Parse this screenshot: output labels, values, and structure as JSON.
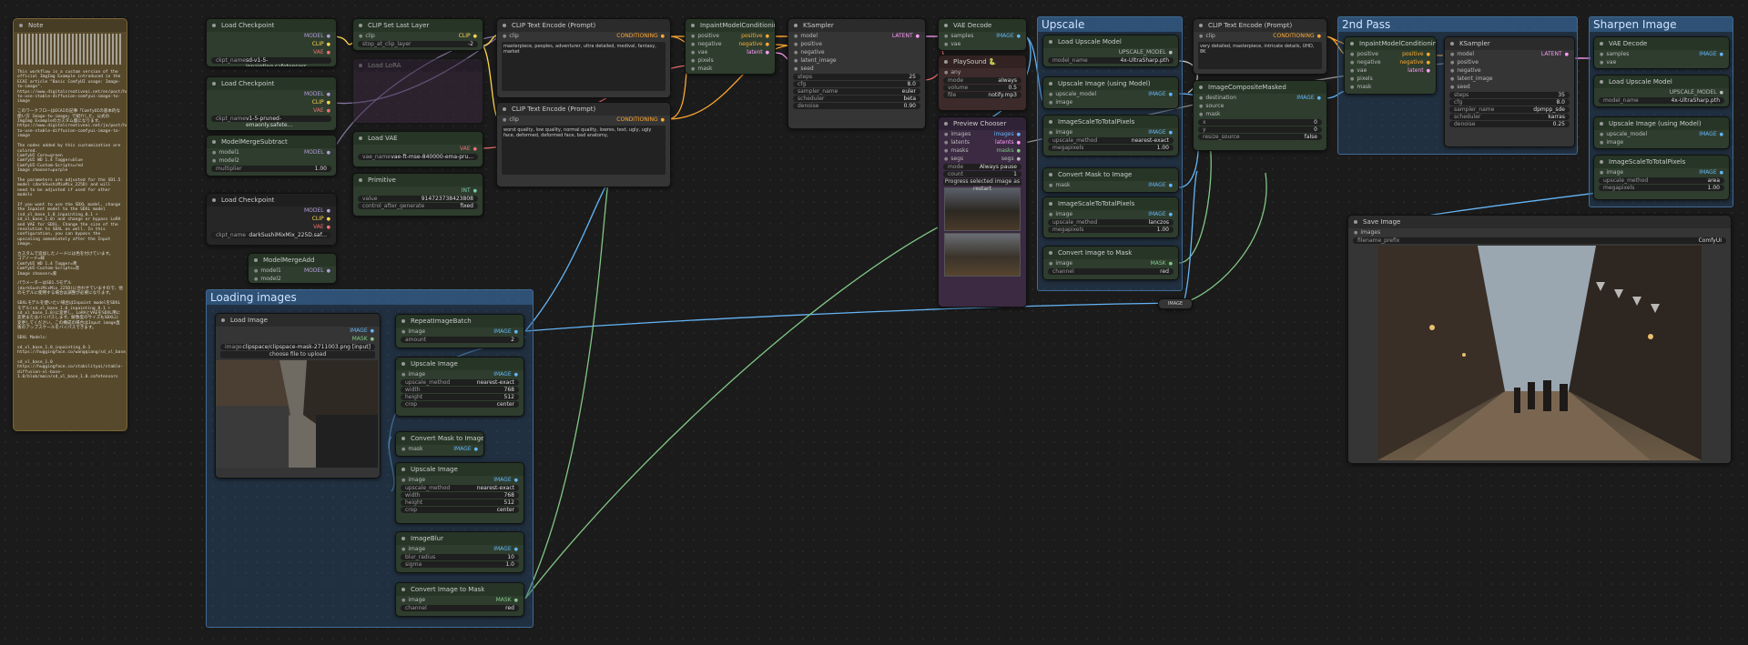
{
  "groups": {
    "loading": "Loading images",
    "upscale": "Upscale",
    "second_pass": "2nd Pass",
    "sharpen": "Sharpen Image"
  },
  "note": {
    "title": "Note",
    "body": "This workflow is a custom version of the official ImgImg Example introduced in the ECAI article \"Basic ComfyUI usage: Image-to-image\".\nhttps://www.digitalcreativeai.net/en/post/how-to-use-stable-diffusion-comfyui-image-to-image\n\nこのワークフローはECAIの記事「ComfyUIの基本的な使い方 Image-to-image」で紹介した、公式のImgImg Exampleのカスタム版になります。\nhttps://www.digitalcreativeai.net/ja/post/how-to-use-stable-diffusion-comfyui-image-to-image\n\nThe nodes added by this customization are colored.\nComfyUI Core=green\nComfyUI WD 1.4 Tagger=blue\nComfyUI-Custom-Scripts=red\nImage chooser=purple\n\nThe parameters are adjusted for the SD1.5 model (darkSushiMixMix_225D) and will need to be adjusted if used for other models\n\nIf you want to use the SDXL model, change the Inpaint model to the SDXL model (sd_xl_base_1.0_inpainting_0.1 + sd_xl_base_1.0) and change or bypass LoRA and VAE for SDXL. Change the size of the resolution to SDXL as well. In this configuration, you can bypass the upscaling immediately after the Input image.\n\nカスタムで追加したノードには色を付けています。\nコアノード=緑\nComfyUI WD 1.4 Tagger=青\nComfyUI-Custom-Scripts=赤\nImage chooser=紫\n\nパラメーターはSD1.5モデル(darkSushiMixMix_225D)に合わせていますので、他のモデルに使用する場合は調整が必要になります。\n\nSDXLモデルを使いたい場合はInpaint modelをSDXLモデル(sd_xl_base_1.0_inpainting_0.1 + sd_xl_base_1.0)に変更し、LoRAとVAEをSDXL用に変更またはバイパスします。解像度のサイズもSDXLに変更してください。この構成の場合はInput image直後のアップスケールをバイパスできます。\n\nSDXL Models:\n\nsd_xl_base_1.0_inpainting_0.1\nhttps://huggingface.co/wangqiang/sd_xl_base_1.0_inpainting_0.1.safetensors/tree/main\n\nsd_xl_base_1.0\nhttps://huggingface.co/stabilityai/stable-diffusion-xl-base-1.0/blob/main/sd_xl_base_1.0.safetensors"
  },
  "ckpt1": {
    "title": "Load Checkpoint",
    "outs": [
      "MODEL",
      "CLIP",
      "VAE"
    ],
    "w_label": "ckpt_name",
    "w_value": "sd-v1-5-inpainting.safetensors"
  },
  "ckpt2": {
    "title": "Load Checkpoint",
    "outs": [
      "MODEL",
      "CLIP",
      "VAE"
    ],
    "w_label": "ckpt_name",
    "w_value": "v1-5-pruned-emaonly.safete..."
  },
  "subtract": {
    "title": "ModelMergeSubtract",
    "ins": [
      "model1",
      "model2"
    ],
    "out": "MODEL",
    "w_label": "multiplier",
    "w_value": "1.00"
  },
  "ckpt3": {
    "title": "Load Checkpoint",
    "outs": [
      "MODEL",
      "CLIP",
      "VAE"
    ],
    "w_label": "ckpt_name",
    "w_value": "darkSushiMixMix_225D.saf..."
  },
  "mergeadd": {
    "title": "ModelMergeAdd",
    "ins": [
      "model1",
      "model2"
    ],
    "out": "MODEL"
  },
  "clipset": {
    "title": "CLIP Set Last Layer",
    "in": "clip",
    "out": "CLIP",
    "w_label": "stop_at_clip_layer",
    "w_value": "-2"
  },
  "lora": {
    "title": "Load LoRA"
  },
  "vae": {
    "title": "Load VAE",
    "out": "VAE",
    "w_label": "vae_name",
    "w_value": "vae-ft-mse-840000-ema-pru..."
  },
  "primitive": {
    "title": "Primitive",
    "out": "INT",
    "w1_label": "value",
    "w1_value": "914723738423808",
    "w2_label": "control_after_generate",
    "w2_value": "fixed"
  },
  "pos": {
    "title": "CLIP Text Encode (Prompt)",
    "in": "clip",
    "out": "CONDITIONING",
    "text": "masterpiece, peoples, adventurer, ultra detailed, medival, fantasy, market"
  },
  "neg": {
    "title": "CLIP Text Encode (Prompt)",
    "in": "clip",
    "out": "CONDITIONING",
    "text": "worst quality, low quality, normal quality, lowres, text, ugly, ugly face, deformed, deformed face, bad anatomy,"
  },
  "inpaint1": {
    "title": "InpaintModelConditioning",
    "ins": [
      "positive",
      "negative",
      "vae",
      "pixels",
      "mask"
    ],
    "outs": [
      "positive",
      "negative",
      "latent"
    ]
  },
  "ksampler1": {
    "title": "KSampler",
    "ins": [
      "model",
      "positive",
      "negative",
      "latent_image",
      "seed"
    ],
    "out": "LATENT",
    "widgets": [
      [
        "steps",
        "25"
      ],
      [
        "cfg",
        "8.0"
      ],
      [
        "sampler_name",
        "euler"
      ],
      [
        "scheduler",
        "beta"
      ],
      [
        "denoise",
        "0.90"
      ]
    ]
  },
  "vaedecode1": {
    "title": "VAE Decode",
    "ins": [
      "samples",
      "vae"
    ],
    "out": "IMAGE"
  },
  "playsound": {
    "title": "PlaySound 🐍",
    "ins": [
      "any"
    ],
    "widgets": [
      [
        "mode",
        "always"
      ],
      [
        "volume",
        "0.5"
      ],
      [
        "file",
        "notify.mp3"
      ]
    ]
  },
  "chooser": {
    "title": "Preview Chooser",
    "ins": [
      "images",
      "latents",
      "masks",
      "segs"
    ],
    "outs": [
      "images",
      "latents",
      "masks",
      "segs"
    ],
    "widgets": [
      [
        "mode",
        "Always pause"
      ],
      [
        "count",
        "1"
      ]
    ],
    "progress": "Progress selected image as restart"
  },
  "upmodel": {
    "title": "Load Upscale Model",
    "out": "UPSCALE_MODEL",
    "w_label": "model_name",
    "w_value": "4x-UltraSharp.pth"
  },
  "upwm": {
    "title": "Upscale Image (using Model)",
    "ins": [
      "upscale_model",
      "image"
    ],
    "out": "IMAGE"
  },
  "scaletotal1": {
    "title": "ImageScaleToTotalPixels",
    "in": "image",
    "out": "IMAGE",
    "widgets": [
      [
        "upscale_method",
        "nearest-exact"
      ],
      [
        "megapixels",
        "1.00"
      ]
    ]
  },
  "convmask1": {
    "title": "Convert Mask to Image",
    "in": "mask",
    "out": "IMAGE"
  },
  "scaletotal2": {
    "title": "ImageScaleToTotalPixels",
    "in": "image",
    "out": "IMAGE",
    "widgets": [
      [
        "upscale_method",
        "lanczos"
      ],
      [
        "megapixels",
        "1.00"
      ]
    ]
  },
  "convimg1": {
    "title": "Convert Image to Mask",
    "in": "image",
    "out": "MASK",
    "w_label": "channel",
    "w_value": "red"
  },
  "pos2": {
    "title": "CLIP Text Encode (Prompt)",
    "in": "clip",
    "out": "CONDITIONING",
    "text": "very detailed, masterpiece, intricate details, UHD, 8K"
  },
  "composite": {
    "title": "ImageCompositeMasked",
    "ins": [
      "destination",
      "source",
      "mask"
    ],
    "out": "IMAGE",
    "widgets": [
      [
        "x",
        "0"
      ],
      [
        "y",
        "0"
      ],
      [
        "resize_source",
        "false"
      ]
    ]
  },
  "inpaint2": {
    "title": "InpaintModelConditioning",
    "ins": [
      "positive",
      "negative",
      "vae",
      "pixels",
      "mask"
    ],
    "outs": [
      "positive",
      "negative",
      "latent"
    ]
  },
  "ksampler2": {
    "title": "KSampler",
    "ins": [
      "model",
      "positive",
      "negative",
      "latent_image",
      "seed"
    ],
    "out": "LATENT",
    "widgets": [
      [
        "steps",
        "35"
      ],
      [
        "cfg",
        "8.0"
      ],
      [
        "sampler_name",
        "dpmpp_sde"
      ],
      [
        "scheduler",
        "karras"
      ],
      [
        "denoise",
        "0.25"
      ]
    ]
  },
  "vaedecode2": {
    "title": "VAE Decode",
    "ins": [
      "samples",
      "vae"
    ],
    "out": "IMAGE"
  },
  "upmodel2": {
    "title": "Load Upscale Model",
    "out": "UPSCALE_MODEL",
    "w_label": "model_name",
    "w_value": "4x-UltraSharp.pth"
  },
  "upwm2": {
    "title": "Upscale Image (using Model)",
    "ins": [
      "upscale_model",
      "image"
    ],
    "out": "IMAGE"
  },
  "scaletotal3": {
    "title": "ImageScaleToTotalPixels",
    "in": "image",
    "out": "IMAGE",
    "widgets": [
      [
        "upscale_method",
        "area"
      ],
      [
        "megapixels",
        "1.00"
      ]
    ]
  },
  "saveimg": {
    "title": "Save Image",
    "in": "images",
    "w_label": "filename_prefix",
    "w_value": "ComfyUI"
  },
  "loadimg": {
    "title": "Load Image",
    "outs": [
      "IMAGE",
      "MASK"
    ],
    "w_label": "image",
    "w_value": "clipspace/clipspace-mask-2711003.png [input]",
    "button": "choose file to upload"
  },
  "repeat": {
    "title": "RepeatImageBatch",
    "in": "image",
    "out": "IMAGE",
    "w_label": "amount",
    "w_value": "2"
  },
  "upimg1": {
    "title": "Upscale Image",
    "in": "image",
    "out": "IMAGE",
    "widgets": [
      [
        "upscale_method",
        "nearest-exact"
      ],
      [
        "width",
        "768"
      ],
      [
        "height",
        "512"
      ],
      [
        "crop",
        "center"
      ]
    ]
  },
  "convmask2": {
    "title": "Convert Mask to Image",
    "in": "mask",
    "out": "IMAGE"
  },
  "upimg2": {
    "title": "Upscale Image",
    "in": "image",
    "out": "IMAGE",
    "widgets": [
      [
        "upscale_method",
        "nearest-exact"
      ],
      [
        "width",
        "768"
      ],
      [
        "height",
        "512"
      ],
      [
        "crop",
        "center"
      ]
    ]
  },
  "blur": {
    "title": "ImageBlur",
    "in": "image",
    "out": "IMAGE",
    "widgets": [
      [
        "blur_radius",
        "10"
      ],
      [
        "sigma",
        "1.0"
      ]
    ]
  },
  "convimg2": {
    "title": "Convert Image to Mask",
    "in": "image",
    "out": "MASK",
    "w_label": "channel",
    "w_value": "red"
  },
  "reroute": {
    "label": "IMAGE"
  },
  "colors": {
    "model": "#b39ddb",
    "clip": "#ffd54f",
    "vae": "#ef7070",
    "cond": "#ffa931",
    "latent": "#ff9cf9",
    "image": "#64b5f6",
    "mask": "#81c784",
    "int": "#7ec8a9"
  }
}
